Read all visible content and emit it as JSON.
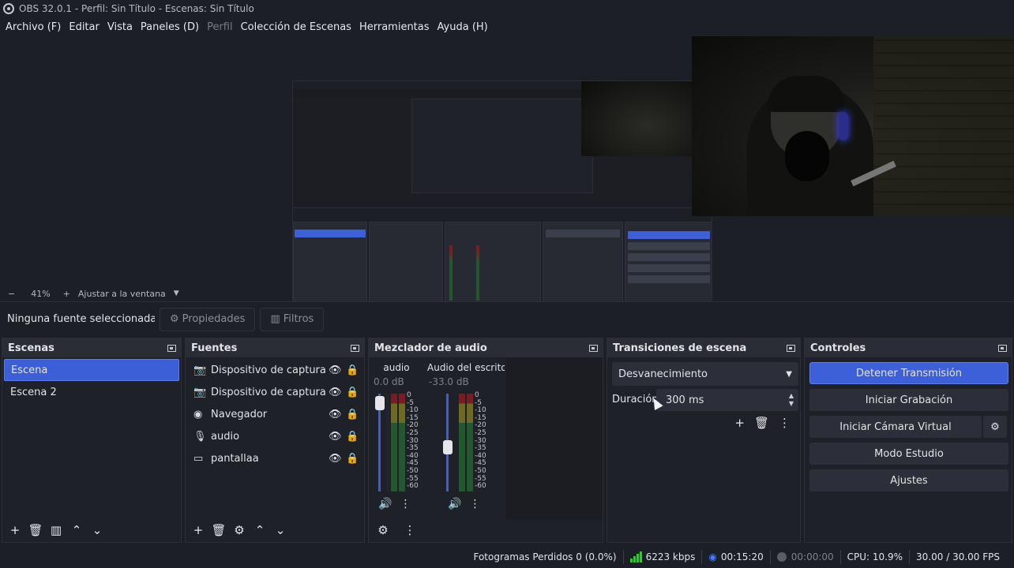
{
  "window": {
    "title": "OBS 32.0.1 - Perfil: Sin Título - Escenas: Sin Título"
  },
  "menu": [
    {
      "label": "Archivo (F)",
      "disabled": false
    },
    {
      "label": "Editar",
      "disabled": false
    },
    {
      "label": "Vista",
      "disabled": false
    },
    {
      "label": "Paneles (D)",
      "disabled": false
    },
    {
      "label": "Perfil",
      "disabled": true
    },
    {
      "label": "Colección de Escenas",
      "disabled": false
    },
    {
      "label": "Herramientas",
      "disabled": false
    },
    {
      "label": "Ayuda (H)",
      "disabled": false
    }
  ],
  "zoom": {
    "minus": "−",
    "value": "41%",
    "plus": "+",
    "fit_label": "Ajustar a la ventana"
  },
  "source_toolbar": {
    "no_selection": "Ninguna fuente seleccionada",
    "properties": "Propiedades",
    "filters": "Filtros"
  },
  "scenes": {
    "title": "Escenas",
    "items": [
      {
        "label": "Escena",
        "selected": true
      },
      {
        "label": "Escena 2",
        "selected": false
      }
    ]
  },
  "sources": {
    "title": "Fuentes",
    "items": [
      {
        "label": "Dispositivo de captura de video",
        "icon": "camera-icon"
      },
      {
        "label": "Dispositivo de captura de video",
        "icon": "camera-icon"
      },
      {
        "label": "Navegador",
        "icon": "globe-icon"
      },
      {
        "label": "audio",
        "icon": "microphone-icon"
      },
      {
        "label": "pantallaa",
        "icon": "monitor-icon"
      }
    ]
  },
  "mixer": {
    "title": "Mezclador de audio",
    "channels": [
      {
        "name": "audio",
        "db": "0.0 dB",
        "level": 0.9
      },
      {
        "name": "Audio del escritorio",
        "db": "-33.0 dB",
        "level": 0.45
      }
    ],
    "scale": [
      "0",
      "-5",
      "-10",
      "-15",
      "-20",
      "-25",
      "-30",
      "-35",
      "-40",
      "-45",
      "-50",
      "-55",
      "-60"
    ]
  },
  "transitions": {
    "title": "Transiciones de escena",
    "selected": "Desvanecimiento",
    "duration_label": "Duración",
    "duration_value": "300 ms"
  },
  "controls": {
    "title": "Controles",
    "stop_stream": "Detener Transmisión",
    "start_recording": "Iniciar Grabación",
    "start_virtual_cam": "Iniciar Cámara Virtual",
    "studio_mode": "Modo Estudio",
    "settings": "Ajustes"
  },
  "status": {
    "dropped_frames": "Fotogramas Perdidos 0 (0.0%)",
    "bitrate": "6223 kbps",
    "stream_time": "00:15:20",
    "record_time": "00:00:00",
    "cpu": "CPU: 10.9%",
    "fps": "30.00 / 30.00 FPS"
  },
  "colors": {
    "accent": "#3d5fd8",
    "panel": "#1f2129",
    "header": "#2a2d36",
    "background": "#1d1f26"
  }
}
